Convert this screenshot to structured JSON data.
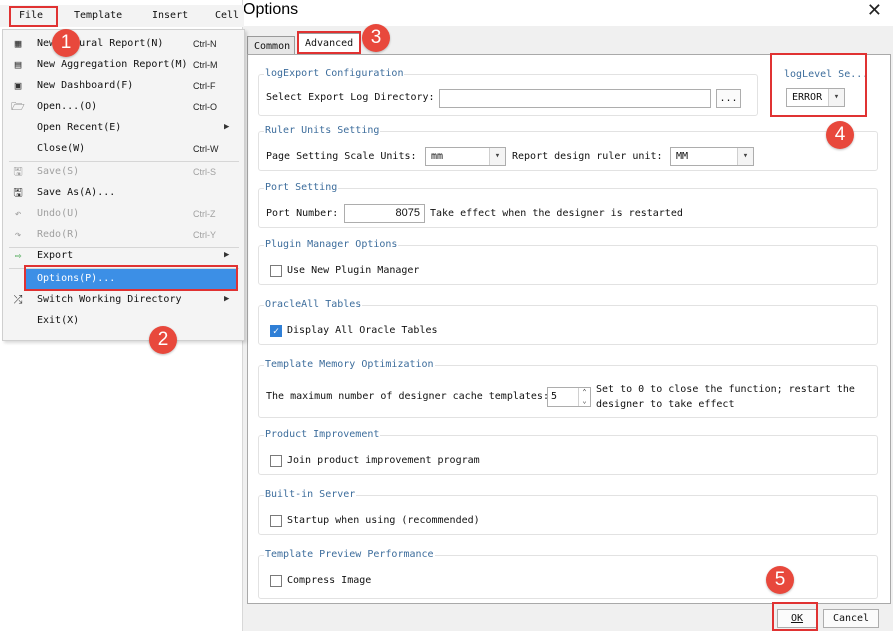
{
  "menubar": {
    "file": "File",
    "template": "Template",
    "insert": "Insert",
    "cell": "Cell"
  },
  "file_menu": [
    {
      "label": "New Cptural Report(N)",
      "shortcut": "Ctrl-N",
      "icon": "grid-report-icon"
    },
    {
      "label": "New Aggregation Report(M)",
      "shortcut": "Ctrl-M",
      "icon": "aggregation-report-icon"
    },
    {
      "label": "New Dashboard(F)",
      "shortcut": "Ctrl-F",
      "icon": "dashboard-icon"
    },
    {
      "label": "Open...(O)",
      "shortcut": "Ctrl-O",
      "icon": "folder-open-icon"
    },
    {
      "label": "Open Recent(E)",
      "shortcut": "",
      "icon": ""
    },
    {
      "label": "Close(W)",
      "shortcut": "Ctrl-W",
      "icon": ""
    },
    {
      "label": "Save(S)",
      "shortcut": "Ctrl-S",
      "icon": "save-icon"
    },
    {
      "label": "Save As(A)...",
      "shortcut": "",
      "icon": "save-as-icon"
    },
    {
      "label": "Undo(U)",
      "shortcut": "Ctrl-Z",
      "icon": "undo-icon"
    },
    {
      "label": "Redo(R)",
      "shortcut": "Ctrl-Y",
      "icon": "redo-icon"
    },
    {
      "label": "Export",
      "shortcut": "",
      "icon": "export-icon"
    },
    {
      "label": "Options(P)...",
      "shortcut": "",
      "icon": ""
    },
    {
      "label": "Switch Working Directory",
      "shortcut": "",
      "icon": "switch-icon"
    },
    {
      "label": "Exit(X)",
      "shortcut": "",
      "icon": ""
    }
  ],
  "dialog": {
    "title": "Options",
    "close_glyph": "✕",
    "tabs": [
      "Common",
      "Advanced"
    ],
    "log_export": {
      "header": "logExport Configuration",
      "label": "Select Export Log Directory:",
      "value": "",
      "browse": "..."
    },
    "log_level": {
      "header": "logLevel Se...",
      "value": "ERROR"
    },
    "ruler": {
      "header": "Ruler Units Setting",
      "page_label": "Page Setting Scale Units:",
      "page_value": "mm",
      "design_label": "Report design ruler unit:",
      "design_value": "MM"
    },
    "port": {
      "header": "Port Setting",
      "label": "Port Number:",
      "value": "8075",
      "note": "Take effect when the designer is restarted"
    },
    "plugin": {
      "header": "Plugin Manager Options",
      "label": "Use New Plugin Manager",
      "checked": false
    },
    "oracle": {
      "header": "OracleAll Tables",
      "label": "Display All Oracle Tables",
      "checked": true
    },
    "template_mem": {
      "header": "Template Memory Optimization",
      "label": "The maximum number of designer cache templates:",
      "value": "5",
      "note1": "Set to 0 to close the function; restart the",
      "note2": "designer to take effect"
    },
    "product": {
      "header": "Product Improvement",
      "label": "Join product improvement program",
      "checked": false
    },
    "server": {
      "header": "Built-in Server",
      "label": "Startup when using (recommended)",
      "checked": false
    },
    "preview": {
      "header": "Template Preview Performance",
      "label": "Compress Image",
      "checked": false
    },
    "ok": "OK",
    "cancel": "Cancel"
  },
  "badges": [
    "1",
    "2",
    "3",
    "4",
    "5"
  ],
  "colors": {
    "annotation": "#e03232",
    "badge": "#e8483c",
    "highlight": "#3c8fe6",
    "section_header": "#3d6d9c"
  }
}
